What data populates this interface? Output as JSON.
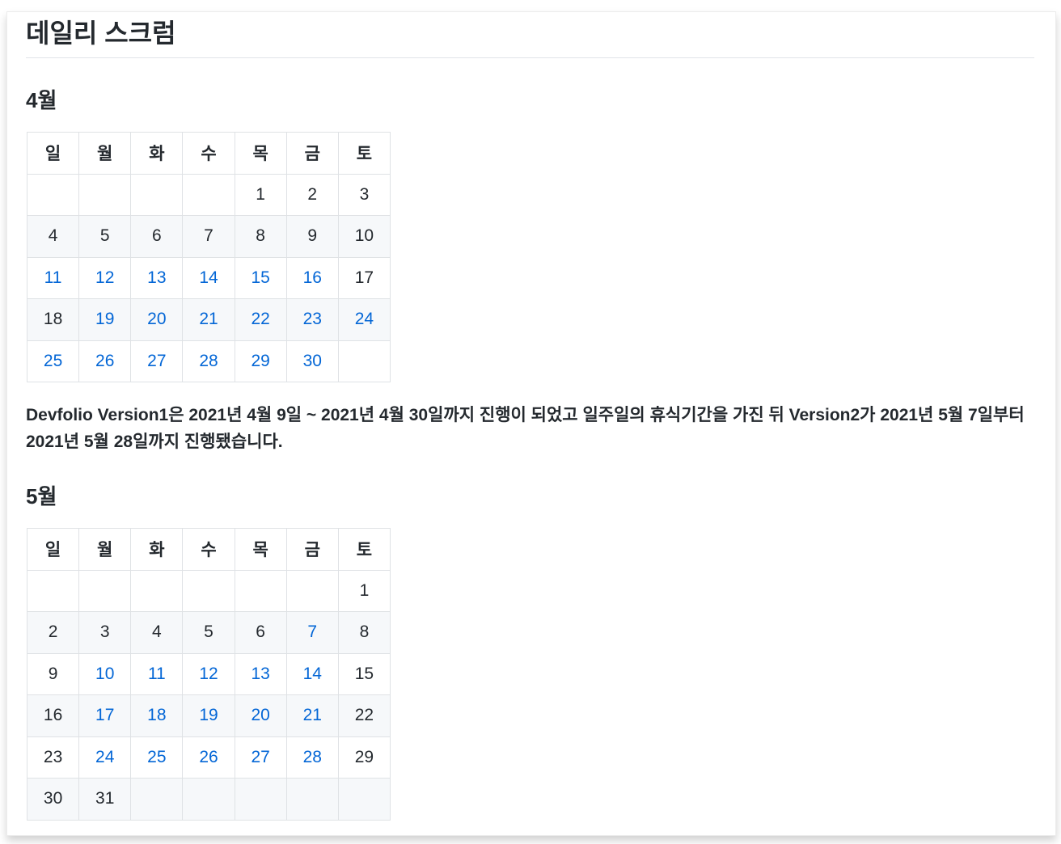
{
  "page": {
    "title": "데일리 스크럼"
  },
  "weekdays": [
    "일",
    "월",
    "화",
    "수",
    "목",
    "금",
    "토"
  ],
  "months": [
    {
      "title": "4월",
      "weeks": [
        [
          {
            "d": ""
          },
          {
            "d": ""
          },
          {
            "d": ""
          },
          {
            "d": ""
          },
          {
            "d": "1"
          },
          {
            "d": "2"
          },
          {
            "d": "3"
          }
        ],
        [
          {
            "d": "4"
          },
          {
            "d": "5"
          },
          {
            "d": "6"
          },
          {
            "d": "7"
          },
          {
            "d": "8"
          },
          {
            "d": "9"
          },
          {
            "d": "10"
          }
        ],
        [
          {
            "d": "11",
            "link": true
          },
          {
            "d": "12",
            "link": true
          },
          {
            "d": "13",
            "link": true
          },
          {
            "d": "14",
            "link": true
          },
          {
            "d": "15",
            "link": true
          },
          {
            "d": "16",
            "link": true
          },
          {
            "d": "17"
          }
        ],
        [
          {
            "d": "18"
          },
          {
            "d": "19",
            "link": true
          },
          {
            "d": "20",
            "link": true
          },
          {
            "d": "21",
            "link": true
          },
          {
            "d": "22",
            "link": true
          },
          {
            "d": "23",
            "link": true
          },
          {
            "d": "24",
            "link": true
          }
        ],
        [
          {
            "d": "25",
            "link": true
          },
          {
            "d": "26",
            "link": true
          },
          {
            "d": "27",
            "link": true
          },
          {
            "d": "28",
            "link": true
          },
          {
            "d": "29",
            "link": true
          },
          {
            "d": "30",
            "link": true
          },
          {
            "d": ""
          }
        ]
      ]
    },
    {
      "title": "5월",
      "weeks": [
        [
          {
            "d": ""
          },
          {
            "d": ""
          },
          {
            "d": ""
          },
          {
            "d": ""
          },
          {
            "d": ""
          },
          {
            "d": ""
          },
          {
            "d": "1"
          }
        ],
        [
          {
            "d": "2"
          },
          {
            "d": "3"
          },
          {
            "d": "4"
          },
          {
            "d": "5"
          },
          {
            "d": "6"
          },
          {
            "d": "7",
            "link": true
          },
          {
            "d": "8"
          }
        ],
        [
          {
            "d": "9"
          },
          {
            "d": "10",
            "link": true
          },
          {
            "d": "11",
            "link": true
          },
          {
            "d": "12",
            "link": true
          },
          {
            "d": "13",
            "link": true
          },
          {
            "d": "14",
            "link": true
          },
          {
            "d": "15"
          }
        ],
        [
          {
            "d": "16"
          },
          {
            "d": "17",
            "link": true
          },
          {
            "d": "18",
            "link": true
          },
          {
            "d": "19",
            "link": true
          },
          {
            "d": "20",
            "link": true
          },
          {
            "d": "21",
            "link": true
          },
          {
            "d": "22"
          }
        ],
        [
          {
            "d": "23"
          },
          {
            "d": "24",
            "link": true
          },
          {
            "d": "25",
            "link": true
          },
          {
            "d": "26",
            "link": true
          },
          {
            "d": "27",
            "link": true
          },
          {
            "d": "28",
            "link": true
          },
          {
            "d": "29"
          }
        ],
        [
          {
            "d": "30"
          },
          {
            "d": "31"
          },
          {
            "d": ""
          },
          {
            "d": ""
          },
          {
            "d": ""
          },
          {
            "d": ""
          },
          {
            "d": ""
          }
        ]
      ]
    }
  ],
  "description": "Devfolio Version1은 2021년 4월 9일 ~ 2021년 4월 30일까지 진행이 되었고 일주일의 휴식기간을 가진 뒤 Version2가 2021년 5월 7일부터 2021년 5월 28일까지 진행됐습니다.",
  "colors": {
    "link": "#0366d6",
    "text": "#24292e",
    "stripe": "#f6f8fa",
    "border": "#dfe2e5"
  }
}
